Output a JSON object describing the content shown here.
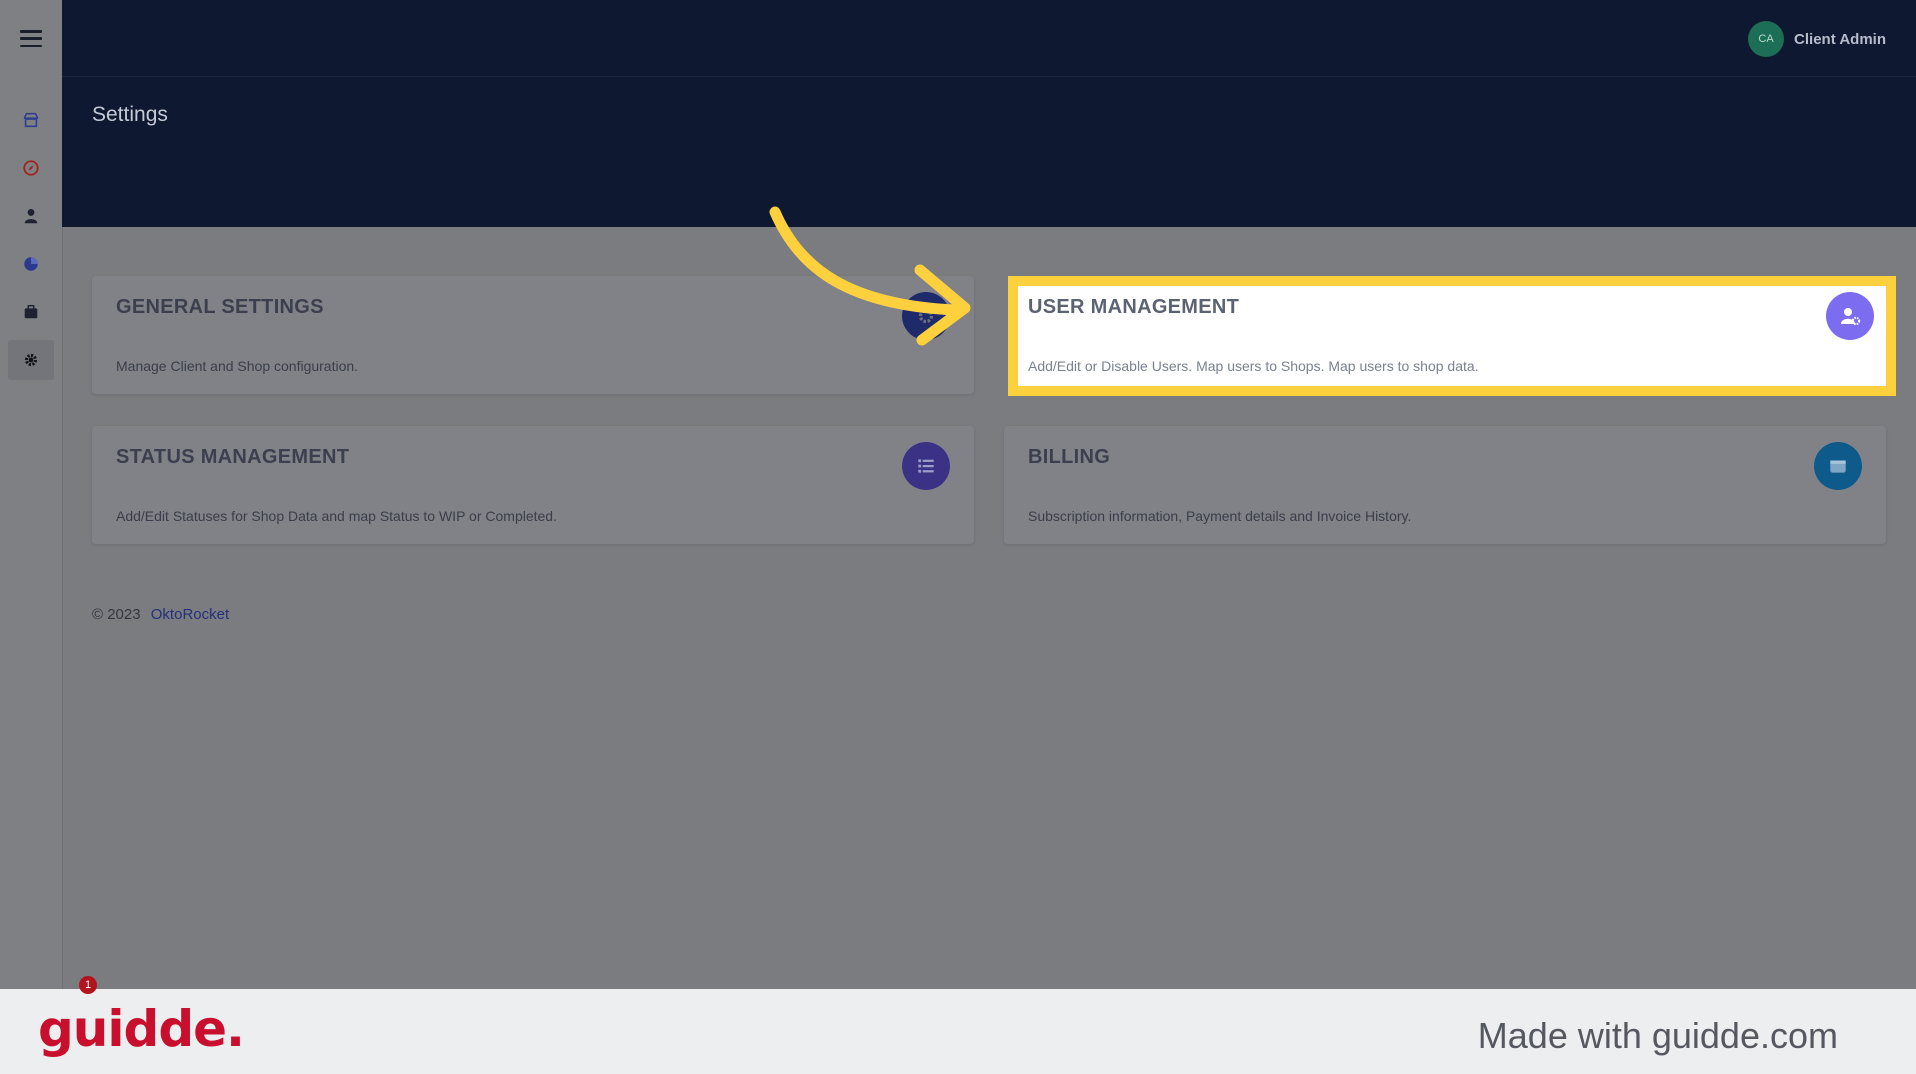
{
  "header": {
    "page_title": "Settings",
    "user_initials": "CA",
    "user_name": "Client Admin"
  },
  "sidebar": {
    "items": [
      {
        "icon": "shop-icon"
      },
      {
        "icon": "compass-icon"
      },
      {
        "icon": "user-icon"
      },
      {
        "icon": "pie-chart-icon"
      },
      {
        "icon": "briefcase-icon"
      },
      {
        "icon": "gear-icon",
        "active": true
      }
    ]
  },
  "cards": [
    {
      "title": "GENERAL SETTINGS",
      "description": "Manage Client and Shop configuration.",
      "icon": "settings-icon",
      "color": "#1f2a6a"
    },
    {
      "title": "USER MANAGEMENT",
      "description": "Add/Edit or Disable Users. Map users to Shops. Map users to shop data.",
      "icon": "user-gear-icon",
      "color": "#7b6cf0",
      "highlighted": true
    },
    {
      "title": "STATUS MANAGEMENT",
      "description": "Add/Edit Statuses for Shop Data and map Status to WIP or Completed.",
      "icon": "list-icon",
      "color": "#3c3285"
    },
    {
      "title": "BILLING",
      "description": "Subscription information, Payment details and Invoice History.",
      "icon": "wallet-icon",
      "color": "#0e5a8a"
    }
  ],
  "footer": {
    "copyright": "© 2023",
    "brand": "OktoRocket"
  },
  "banner": {
    "logo": "guidde.",
    "tagline": "Made with guidde.com",
    "notification_count": "1"
  },
  "colors": {
    "highlight": "#fdd13e",
    "header_bg": "#0e1830",
    "arrow": "#fdd13e"
  }
}
